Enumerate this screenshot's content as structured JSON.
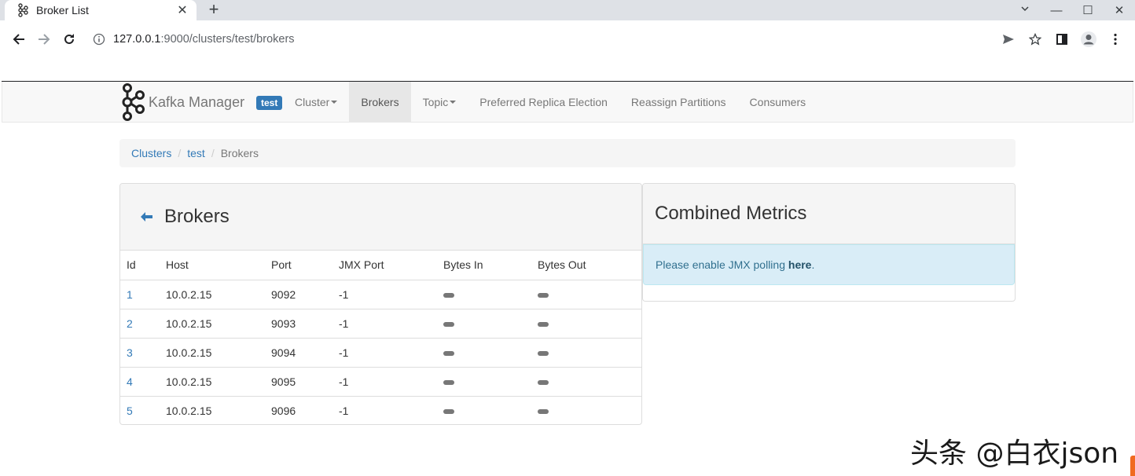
{
  "browser": {
    "tab_title": "Broker List",
    "tab_close": "✕",
    "new_tab": "+",
    "url_host": "127.0.0.1",
    "url_path": ":9000/clusters/test/brokers",
    "window_controls": {
      "minimize": "—",
      "maximize": "☐",
      "close": "✕"
    }
  },
  "navbar": {
    "brand": "Kafka Manager",
    "cluster_badge": "test",
    "items": [
      {
        "label": "Cluster",
        "dropdown": true,
        "active": false
      },
      {
        "label": "Brokers",
        "dropdown": false,
        "active": true
      },
      {
        "label": "Topic",
        "dropdown": true,
        "active": false
      },
      {
        "label": "Preferred Replica Election",
        "dropdown": false,
        "active": false
      },
      {
        "label": "Reassign Partitions",
        "dropdown": false,
        "active": false
      },
      {
        "label": "Consumers",
        "dropdown": false,
        "active": false
      }
    ]
  },
  "breadcrumb": {
    "items": [
      "Clusters",
      "test"
    ],
    "separator": "/",
    "active": "Brokers"
  },
  "brokers_panel": {
    "title": "Brokers",
    "columns": [
      "Id",
      "Host",
      "Port",
      "JMX Port",
      "Bytes In",
      "Bytes Out"
    ],
    "rows": [
      {
        "id": "1",
        "host": "10.0.2.15",
        "port": "9092",
        "jmx_port": "-1"
      },
      {
        "id": "2",
        "host": "10.0.2.15",
        "port": "9093",
        "jmx_port": "-1"
      },
      {
        "id": "3",
        "host": "10.0.2.15",
        "port": "9094",
        "jmx_port": "-1"
      },
      {
        "id": "4",
        "host": "10.0.2.15",
        "port": "9095",
        "jmx_port": "-1"
      },
      {
        "id": "5",
        "host": "10.0.2.15",
        "port": "9096",
        "jmx_port": "-1"
      }
    ]
  },
  "metrics_panel": {
    "title": "Combined Metrics",
    "alert_text": "Please enable JMX polling ",
    "alert_link": "here",
    "alert_suffix": "."
  },
  "watermark": "头条 @白衣json",
  "colors": {
    "link": "#337ab7",
    "badge": "#337ab7",
    "alert_bg": "#d9edf7",
    "alert_text": "#31708f"
  }
}
